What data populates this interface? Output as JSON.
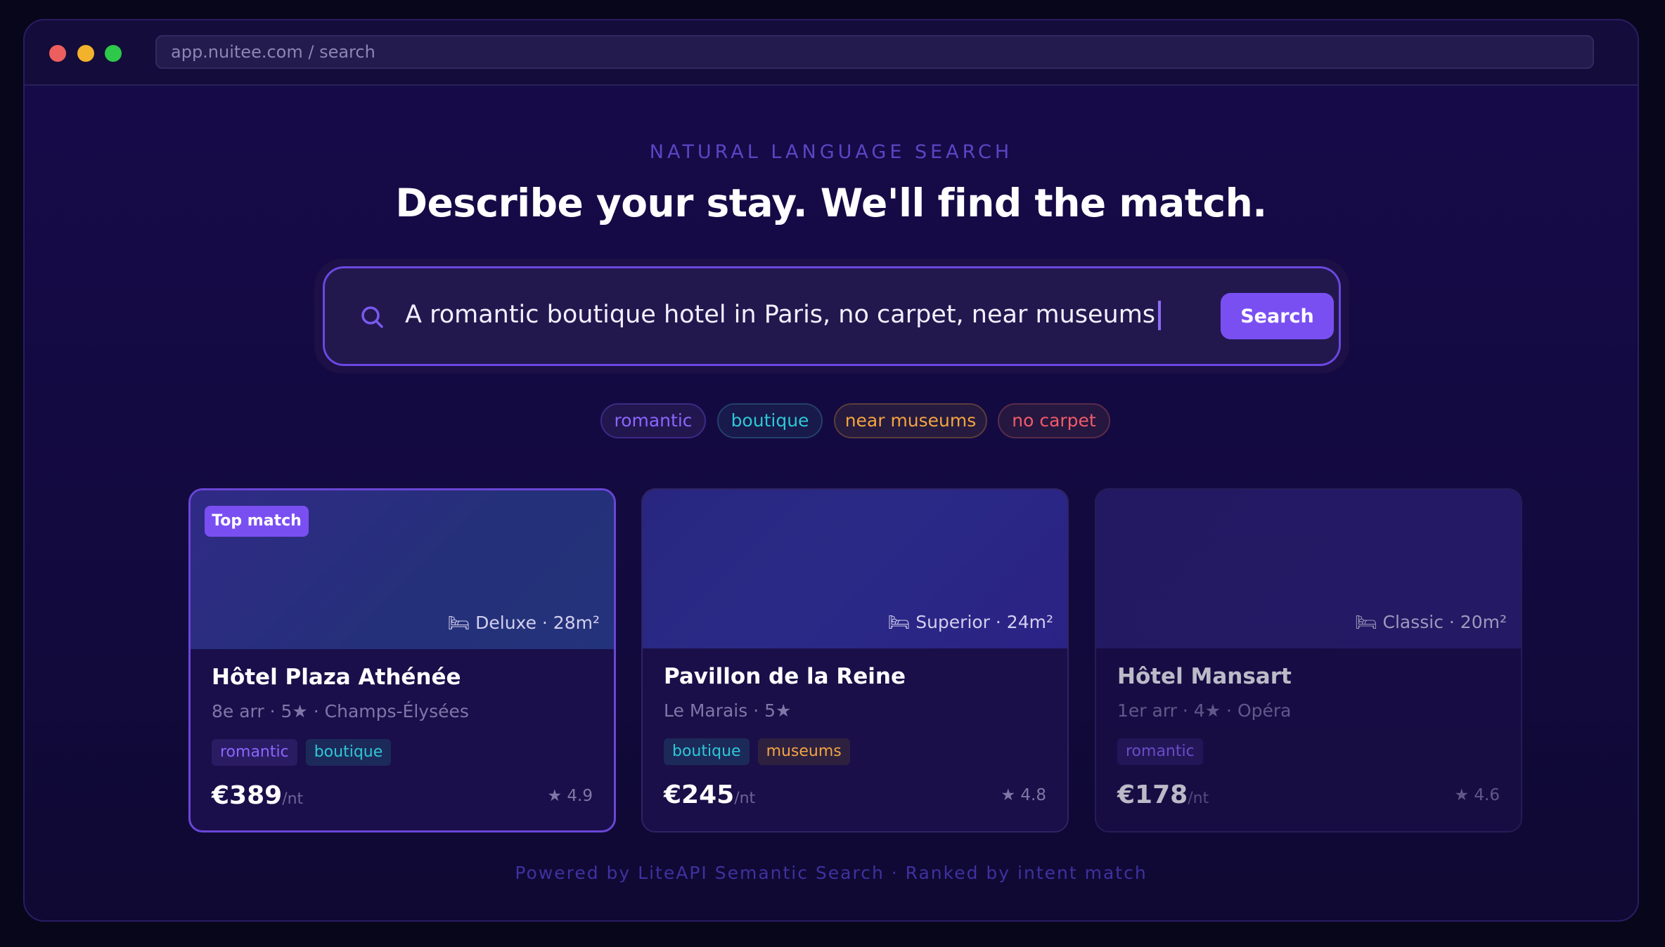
{
  "browser": {
    "url": "app.nuitee.com / search"
  },
  "hero": {
    "kicker": "NATURAL LANGUAGE SEARCH",
    "headline": "Describe your stay. We'll find the match."
  },
  "search": {
    "query": "A romantic boutique hotel in Paris, no carpet, near museums",
    "button_label": "Search"
  },
  "intent_chips": [
    {
      "label": "romantic",
      "color": "#8b66ff"
    },
    {
      "label": "boutique",
      "color": "#2fc7d5"
    },
    {
      "label": "near museums",
      "color": "#f3a441"
    },
    {
      "label": "no carpet",
      "color": "#f15b6a"
    }
  ],
  "results": [
    {
      "badge": "Top match",
      "room": "🛏 Deluxe · 28m²",
      "name": "Hôtel Plaza Athénée",
      "meta": "8e arr · 5★ · Champs-Élysées",
      "tags": [
        "romantic",
        "boutique"
      ],
      "price": "€389",
      "price_unit": "/nt",
      "rating": "★ 4.9"
    },
    {
      "room": "🛏 Superior · 24m²",
      "name": "Pavillon de la Reine",
      "meta": "Le Marais · 5★",
      "tags": [
        "boutique",
        "museums"
      ],
      "price": "€245",
      "price_unit": "/nt",
      "rating": "★ 4.8"
    },
    {
      "room": "🛏 Classic · 20m²",
      "name": "Hôtel Mansart",
      "meta": "1er arr · 4★ · Opéra",
      "tags": [
        "romantic"
      ],
      "price": "€178",
      "price_unit": "/nt",
      "rating": "★ 4.6"
    }
  ],
  "footer": "Powered by LiteAPI Semantic Search · Ranked by intent match",
  "colors": {
    "accent": "#7a4ff2",
    "background": "#130a40"
  }
}
